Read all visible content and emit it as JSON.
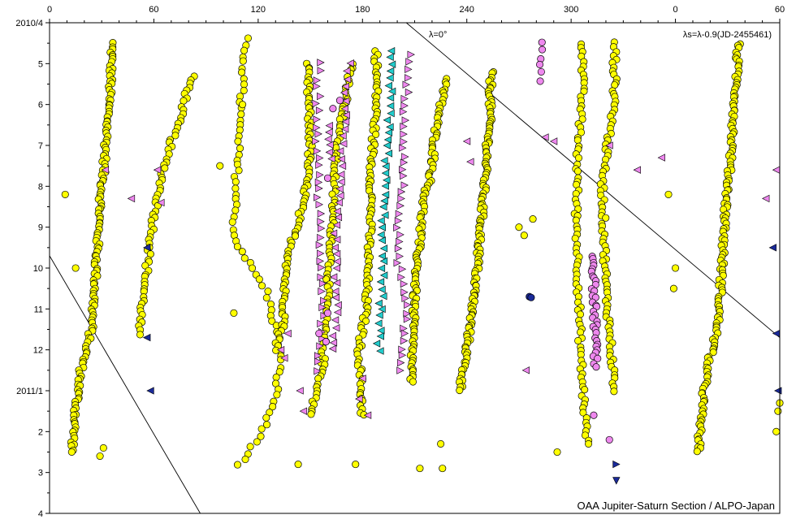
{
  "chart_data": {
    "type": "scatter",
    "title": "",
    "credit": "OAA Jupiter-Saturn Section / ALPO-Japan",
    "system_label": "λs=λ-0.9(JD-2455461)",
    "zero_line_label": "λ=0°",
    "x_ticks": [
      "0",
      "60",
      "120",
      "180",
      "240",
      "300",
      "0",
      "60"
    ],
    "y_ticks": [
      "2010/4",
      "5",
      "6",
      "7",
      "8",
      "9",
      "10",
      "11",
      "12",
      "2011/1",
      "2",
      "3",
      "4"
    ],
    "xlim": [
      0,
      420
    ],
    "ylim": [
      0,
      12
    ],
    "x_unit": "longitude (deg, wraps at 360)",
    "y_unit": "months since 2010/4",
    "grid": false,
    "colors": {
      "yellow": "#ffff00",
      "pink": "#ee88ee",
      "cyan": "#22cccc",
      "navy": "#1a2a99",
      "outline": "#000000"
    },
    "diagonal_lines": [
      {
        "name": "lambda-zero-line",
        "points": [
          [
            205.2,
            0
          ],
          [
            420,
            7.7
          ]
        ]
      },
      {
        "name": "lambda-zero-line-wrapped",
        "points": [
          [
            0,
            5.7
          ],
          [
            86.7,
            12
          ]
        ]
      }
    ],
    "tracks": [
      {
        "marker": "circle",
        "color": "yellow",
        "n": 150,
        "points": [
          [
            36,
            0.5
          ],
          [
            35,
            1.5
          ],
          [
            32,
            3.2
          ],
          [
            29,
            4.5
          ],
          [
            27,
            5.8
          ],
          [
            26,
            6.5
          ],
          [
            24,
            7.5
          ],
          [
            18,
            8.5
          ],
          [
            15,
            9.5
          ],
          [
            13,
            10.5
          ]
        ]
      },
      {
        "marker": "circle",
        "color": "yellow",
        "n": 70,
        "points": [
          [
            82,
            1.3
          ],
          [
            75,
            2.3
          ],
          [
            67,
            3.3
          ],
          [
            60,
            4.8
          ],
          [
            56,
            6.0
          ],
          [
            53,
            7.0
          ],
          [
            51,
            7.6
          ]
        ]
      },
      {
        "marker": "circle",
        "color": "yellow",
        "n": 75,
        "points": [
          [
            113,
            0.4
          ],
          [
            109,
            2.5
          ],
          [
            106,
            5.2
          ],
          [
            116,
            6.0
          ],
          [
            125,
            6.6
          ],
          [
            133,
            8.0
          ],
          [
            130,
            9.2
          ],
          [
            120,
            10.2
          ],
          [
            109,
            10.8
          ]
        ]
      },
      {
        "marker": "circle",
        "color": "yellow",
        "n": 90,
        "points": [
          [
            148,
            1.0
          ],
          [
            149,
            2.0
          ],
          [
            150,
            3.0
          ],
          [
            147,
            4.2
          ],
          [
            138,
            5.6
          ],
          [
            135,
            6.5
          ],
          [
            135,
            7.3
          ],
          [
            130,
            8.0
          ]
        ]
      },
      {
        "marker": "circle",
        "color": "yellow",
        "n": 100,
        "points": [
          [
            174,
            1.0
          ],
          [
            170,
            2.0
          ],
          [
            165,
            3.0
          ],
          [
            163,
            4.5
          ],
          [
            162,
            5.5
          ],
          [
            160,
            6.5
          ],
          [
            158,
            7.6
          ],
          [
            157,
            8.5
          ],
          [
            150,
            9.6
          ]
        ]
      },
      {
        "marker": "circle",
        "color": "yellow",
        "n": 110,
        "points": [
          [
            188,
            0.7
          ],
          [
            188,
            2.0
          ],
          [
            185,
            3.5
          ],
          [
            185,
            4.5
          ],
          [
            183,
            6.0
          ],
          [
            182,
            7.0
          ],
          [
            178,
            8.0
          ],
          [
            180,
            9.6
          ]
        ]
      },
      {
        "marker": "circle",
        "color": "yellow",
        "n": 110,
        "points": [
          [
            228,
            1.4
          ],
          [
            222,
            2.6
          ],
          [
            220,
            3.6
          ],
          [
            215,
            4.4
          ],
          [
            212,
            5.6
          ],
          [
            210,
            6.6
          ],
          [
            209,
            7.6
          ],
          [
            208,
            8.8
          ]
        ]
      },
      {
        "marker": "circle",
        "color": "yellow",
        "n": 130,
        "points": [
          [
            254,
            1.2
          ],
          [
            253,
            2.5
          ],
          [
            250,
            4.0
          ],
          [
            248,
            5.0
          ],
          [
            246,
            6.0
          ],
          [
            243,
            7.0
          ],
          [
            240,
            8.0
          ],
          [
            236,
            9.0
          ]
        ]
      },
      {
        "marker": "circle",
        "color": "yellow",
        "n": 90,
        "points": [
          [
            307,
            0.5
          ],
          [
            306,
            2.0
          ],
          [
            304,
            3.0
          ],
          [
            303,
            4.5
          ],
          [
            304,
            6.2
          ],
          [
            305,
            7.6
          ],
          [
            306,
            8.5
          ],
          [
            309,
            10.2
          ]
        ]
      },
      {
        "marker": "circle",
        "color": "yellow",
        "n": 90,
        "points": [
          [
            325,
            0.5
          ],
          [
            325,
            2.0
          ],
          [
            320,
            3.2
          ],
          [
            318,
            4.0
          ],
          [
            320,
            6.5
          ],
          [
            322,
            7.5
          ],
          [
            325,
            9.0
          ]
        ]
      },
      {
        "marker": "circle",
        "color": "yellow",
        "n": 150,
        "points": [
          [
            396,
            0.5
          ],
          [
            395,
            1.5
          ],
          [
            392,
            3.2
          ],
          [
            389,
            4.5
          ],
          [
            387,
            5.8
          ],
          [
            386,
            6.5
          ],
          [
            384,
            7.5
          ],
          [
            378,
            8.5
          ],
          [
            375,
            9.5
          ],
          [
            373,
            10.5
          ]
        ]
      },
      {
        "marker": "tri-right",
        "color": "pink",
        "n": 40,
        "points": [
          [
            155,
            1.0
          ],
          [
            154,
            3.0
          ],
          [
            156,
            5.5
          ],
          [
            158,
            7.0
          ],
          [
            154,
            8.5
          ]
        ]
      },
      {
        "marker": "tri-left",
        "color": "pink",
        "n": 40,
        "points": [
          [
            172,
            1.0
          ],
          [
            168,
            3.0
          ],
          [
            164,
            5.5
          ],
          [
            165,
            7.0
          ],
          [
            162,
            8.0
          ]
        ]
      },
      {
        "marker": "tri-left",
        "color": "cyan",
        "n": 45,
        "points": [
          [
            197,
            0.7
          ],
          [
            195,
            2.5
          ],
          [
            192,
            4.5
          ],
          [
            191,
            6.5
          ],
          [
            189,
            8.0
          ]
        ]
      },
      {
        "marker": "tri-right",
        "color": "pink",
        "n": 45,
        "points": [
          [
            207,
            0.8
          ],
          [
            204,
            2.5
          ],
          [
            203,
            4.0
          ],
          [
            200,
            5.5
          ],
          [
            205,
            7.0
          ],
          [
            202,
            8.5
          ]
        ]
      },
      {
        "marker": "circle",
        "color": "pink",
        "n": 35,
        "points": [
          [
            313,
            5.7
          ],
          [
            313,
            6.5
          ],
          [
            314,
            7.6
          ],
          [
            314,
            8.4
          ]
        ]
      },
      {
        "marker": "circle",
        "color": "pink",
        "n": 6,
        "points": [
          [
            282,
            0.5
          ],
          [
            283,
            1.4
          ]
        ]
      },
      {
        "marker": "tri-left",
        "color": "pink",
        "n": 6,
        "points": [
          [
            160,
            2.5
          ],
          [
            162,
            3.3
          ]
        ]
      }
    ],
    "extra_points": [
      {
        "marker": "circle",
        "color": "yellow",
        "x": 9,
        "y": 4.2
      },
      {
        "marker": "circle",
        "color": "yellow",
        "x": 15,
        "y": 6.0
      },
      {
        "marker": "circle",
        "color": "yellow",
        "x": 98,
        "y": 3.5
      },
      {
        "marker": "circle",
        "color": "yellow",
        "x": 106,
        "y": 7.1
      },
      {
        "marker": "circle",
        "color": "yellow",
        "x": 111,
        "y": 2.0
      },
      {
        "marker": "circle",
        "color": "yellow",
        "x": 270,
        "y": 5.0
      },
      {
        "marker": "circle",
        "color": "yellow",
        "x": 273,
        "y": 5.2
      },
      {
        "marker": "circle",
        "color": "yellow",
        "x": 278,
        "y": 4.8
      },
      {
        "marker": "circle",
        "color": "yellow",
        "x": 225,
        "y": 10.3
      },
      {
        "marker": "circle",
        "color": "yellow",
        "x": 356,
        "y": 4.2
      },
      {
        "marker": "circle",
        "color": "yellow",
        "x": 360,
        "y": 6.0
      },
      {
        "marker": "circle",
        "color": "yellow",
        "x": 359,
        "y": 6.5
      },
      {
        "marker": "circle",
        "color": "yellow",
        "x": 420,
        "y": 9.3
      },
      {
        "marker": "circle",
        "color": "yellow",
        "x": 419,
        "y": 9.5
      },
      {
        "marker": "circle",
        "color": "yellow",
        "x": 418,
        "y": 10.0
      },
      {
        "marker": "circle",
        "color": "yellow",
        "x": 143,
        "y": 10.8
      },
      {
        "marker": "circle",
        "color": "yellow",
        "x": 176,
        "y": 10.8
      },
      {
        "marker": "circle",
        "color": "yellow",
        "x": 213,
        "y": 10.9
      },
      {
        "marker": "circle",
        "color": "yellow",
        "x": 226,
        "y": 10.9
      },
      {
        "marker": "circle",
        "color": "yellow",
        "x": 292,
        "y": 10.5
      },
      {
        "marker": "circle",
        "color": "yellow",
        "x": 310,
        "y": 10.3
      },
      {
        "marker": "circle",
        "color": "yellow",
        "x": 29,
        "y": 10.6
      },
      {
        "marker": "circle",
        "color": "yellow",
        "x": 31,
        "y": 10.4
      },
      {
        "marker": "circle",
        "color": "navy",
        "x": 276,
        "y": 6.7
      },
      {
        "marker": "circle",
        "color": "navy",
        "x": 277,
        "y": 6.72
      },
      {
        "marker": "tri-left",
        "color": "navy",
        "x": 56,
        "y": 5.5
      },
      {
        "marker": "tri-left",
        "color": "navy",
        "x": 56,
        "y": 7.7
      },
      {
        "marker": "tri-left",
        "color": "navy",
        "x": 58,
        "y": 9.0
      },
      {
        "marker": "tri-left",
        "color": "navy",
        "x": 416,
        "y": 5.5
      },
      {
        "marker": "tri-left",
        "color": "navy",
        "x": 418,
        "y": 7.6
      },
      {
        "marker": "tri-left",
        "color": "navy",
        "x": 419,
        "y": 9.0
      },
      {
        "marker": "tri-right",
        "color": "navy",
        "x": 326,
        "y": 10.8
      },
      {
        "marker": "tri-down",
        "color": "navy",
        "x": 326,
        "y": 11.2
      },
      {
        "marker": "tri-left",
        "color": "pink",
        "x": 322,
        "y": 3.0
      },
      {
        "marker": "tri-left",
        "color": "pink",
        "x": 338,
        "y": 3.6
      },
      {
        "marker": "tri-left",
        "color": "pink",
        "x": 352,
        "y": 3.3
      },
      {
        "marker": "tri-left",
        "color": "pink",
        "x": 412,
        "y": 4.3
      },
      {
        "marker": "tri-left",
        "color": "pink",
        "x": 418,
        "y": 3.6
      },
      {
        "marker": "tri-left",
        "color": "pink",
        "x": 274,
        "y": 8.5
      },
      {
        "marker": "tri-left",
        "color": "pink",
        "x": 285,
        "y": 2.8
      },
      {
        "marker": "tri-left",
        "color": "pink",
        "x": 290,
        "y": 2.9
      },
      {
        "marker": "tri-left",
        "color": "pink",
        "x": 240,
        "y": 2.9
      },
      {
        "marker": "tri-left",
        "color": "pink",
        "x": 242,
        "y": 3.4
      },
      {
        "marker": "tri-left",
        "color": "pink",
        "x": 137,
        "y": 7.6
      },
      {
        "marker": "tri-left",
        "color": "pink",
        "x": 133,
        "y": 8.0
      },
      {
        "marker": "tri-left",
        "color": "pink",
        "x": 135,
        "y": 8.2
      },
      {
        "marker": "tri-left",
        "color": "pink",
        "x": 47,
        "y": 4.3
      },
      {
        "marker": "tri-left",
        "color": "pink",
        "x": 32,
        "y": 3.6
      },
      {
        "marker": "tri-left",
        "color": "pink",
        "x": 62,
        "y": 3.6
      },
      {
        "marker": "tri-left",
        "color": "pink",
        "x": 64,
        "y": 4.4
      },
      {
        "marker": "tri-left",
        "color": "pink",
        "x": 178,
        "y": 9.2
      },
      {
        "marker": "tri-left",
        "color": "pink",
        "x": 180,
        "y": 8.7
      },
      {
        "marker": "tri-left",
        "color": "pink",
        "x": 144,
        "y": 9.0
      },
      {
        "marker": "tri-left",
        "color": "pink",
        "x": 146,
        "y": 9.5
      },
      {
        "marker": "tri-left",
        "color": "pink",
        "x": 183,
        "y": 9.6
      },
      {
        "marker": "circle",
        "color": "pink",
        "x": 167,
        "y": 1.9
      },
      {
        "marker": "circle",
        "color": "pink",
        "x": 163,
        "y": 2.1
      },
      {
        "marker": "circle",
        "color": "pink",
        "x": 160,
        "y": 3.8
      },
      {
        "marker": "circle",
        "color": "pink",
        "x": 160,
        "y": 7.1
      },
      {
        "marker": "circle",
        "color": "pink",
        "x": 155,
        "y": 7.6
      },
      {
        "marker": "circle",
        "color": "pink",
        "x": 159,
        "y": 7.8
      },
      {
        "marker": "circle",
        "color": "pink",
        "x": 322,
        "y": 10.2
      },
      {
        "marker": "circle",
        "color": "pink",
        "x": 313,
        "y": 9.6
      }
    ]
  }
}
